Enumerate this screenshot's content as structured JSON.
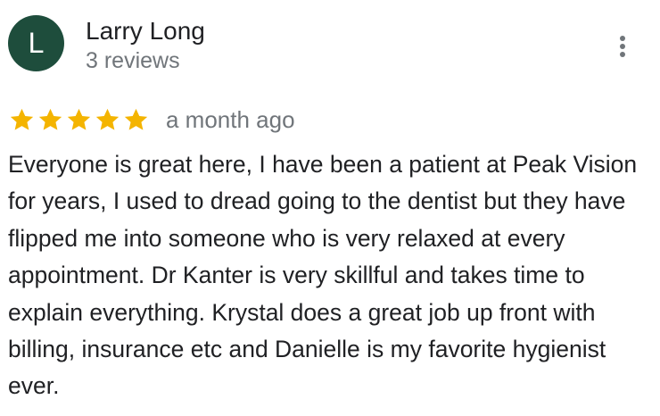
{
  "reviewer": {
    "avatar_initial": "L",
    "name": "Larry Long",
    "review_count": "3 reviews",
    "avatar_color": "#1e4d3c"
  },
  "review": {
    "rating": 5,
    "max_rating": 5,
    "star_color": "#f4b400",
    "time": "a month ago",
    "text": "Everyone is great here, I have been a patient at Peak Vision for years, I used to dread going to the dentist but they have flipped me into someone who is very relaxed at every appointment. Dr Kanter is very skillful and takes time to explain everything. Krystal does a great job up front with billing, insurance etc and Danielle is my favorite hygienist ever."
  },
  "actions": {
    "more_icon": "more-vert-icon"
  }
}
